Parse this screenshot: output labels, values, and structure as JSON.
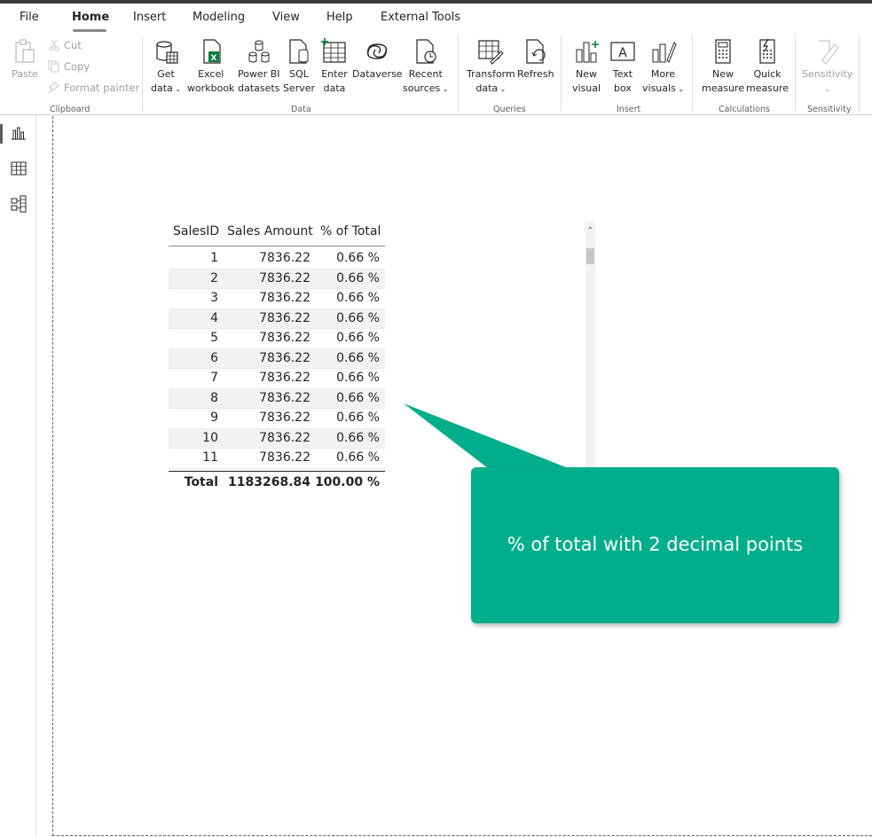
{
  "menu": {
    "items": [
      "File",
      "Home",
      "Insert",
      "Modeling",
      "View",
      "Help",
      "External Tools"
    ],
    "active": "Home"
  },
  "ribbon": {
    "clipboard": {
      "paste": "Paste",
      "cut": "Cut",
      "copy": "Copy",
      "format_painter": "Format painter",
      "label": "Clipboard"
    },
    "data": {
      "get_data": [
        "Get",
        "data"
      ],
      "excel": [
        "Excel",
        "workbook"
      ],
      "powerbi": [
        "Power BI",
        "datasets"
      ],
      "sql": [
        "SQL",
        "Server"
      ],
      "enter": [
        "Enter",
        "data"
      ],
      "dataverse": "Dataverse",
      "recent": [
        "Recent",
        "sources"
      ],
      "label": "Data"
    },
    "queries": {
      "transform": [
        "Transform",
        "data"
      ],
      "refresh": "Refresh",
      "label": "Queries"
    },
    "insert": {
      "new_visual": [
        "New",
        "visual"
      ],
      "text_box": [
        "Text",
        "box"
      ],
      "more_visuals": [
        "More",
        "visuals"
      ],
      "label": "Insert"
    },
    "calculations": {
      "new_measure": [
        "New",
        "measure"
      ],
      "quick_measure": [
        "Quick",
        "measure"
      ],
      "label": "Calculations"
    },
    "sensitivity": {
      "button": "Sensitivity",
      "label": "Sensitivity"
    }
  },
  "table": {
    "headers": [
      "SalesID",
      "Sales Amount",
      "% of Total"
    ],
    "rows": [
      [
        "1",
        "7836.22",
        "0.66 %"
      ],
      [
        "2",
        "7836.22",
        "0.66 %"
      ],
      [
        "3",
        "7836.22",
        "0.66 %"
      ],
      [
        "4",
        "7836.22",
        "0.66 %"
      ],
      [
        "5",
        "7836.22",
        "0.66 %"
      ],
      [
        "6",
        "7836.22",
        "0.66 %"
      ],
      [
        "7",
        "7836.22",
        "0.66 %"
      ],
      [
        "8",
        "7836.22",
        "0.66 %"
      ],
      [
        "9",
        "7836.22",
        "0.66 %"
      ],
      [
        "10",
        "7836.22",
        "0.66 %"
      ],
      [
        "11",
        "7836.22",
        "0.66 %"
      ]
    ],
    "total": [
      "Total",
      "1183268.84",
      "100.00 %"
    ]
  },
  "callout": {
    "text": "% of total with 2 decimal points",
    "color": "#01ae8b"
  },
  "icons": {
    "rail": [
      "report-view-icon",
      "table-view-icon",
      "model-view-icon"
    ]
  }
}
